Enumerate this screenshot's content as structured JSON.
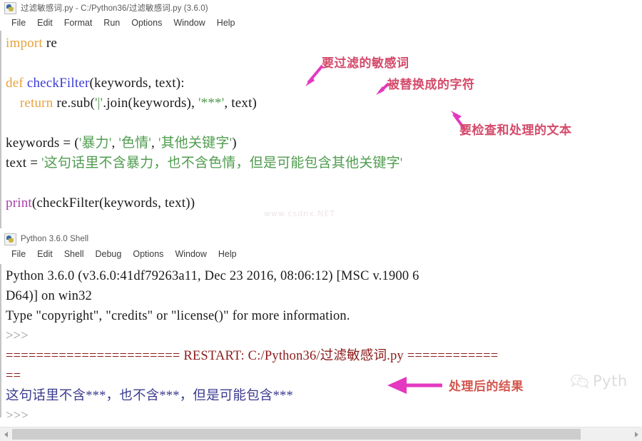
{
  "editor_window": {
    "title": "过滤敏感词.py - C:/Python36/过滤敏感词.py (3.6.0)",
    "icon": "python-file-icon",
    "menu": [
      "File",
      "Edit",
      "Format",
      "Run",
      "Options",
      "Window",
      "Help"
    ],
    "code_lines": [
      {
        "id": "l1",
        "segments": [
          {
            "t": "import",
            "c": "kw"
          },
          {
            "t": " re",
            "c": "plain"
          }
        ]
      },
      {
        "id": "l2",
        "segments": [
          {
            "t": "",
            "c": "plain"
          }
        ]
      },
      {
        "id": "l3",
        "segments": [
          {
            "t": "def",
            "c": "kw"
          },
          {
            "t": " ",
            "c": "plain"
          },
          {
            "t": "checkFilter",
            "c": "fn"
          },
          {
            "t": "(keywords, text):",
            "c": "plain"
          }
        ]
      },
      {
        "id": "l4",
        "segments": [
          {
            "t": "    ",
            "c": "plain"
          },
          {
            "t": "return",
            "c": "kw"
          },
          {
            "t": " re.sub(",
            "c": "plain"
          },
          {
            "t": "'|'",
            "c": "str"
          },
          {
            "t": ".join(keywords), ",
            "c": "plain"
          },
          {
            "t": "'***'",
            "c": "str"
          },
          {
            "t": ", text)",
            "c": "plain"
          }
        ]
      },
      {
        "id": "l5",
        "segments": [
          {
            "t": "",
            "c": "plain"
          }
        ]
      },
      {
        "id": "l6",
        "segments": [
          {
            "t": "keywords = (",
            "c": "plain"
          },
          {
            "t": "'暴力'",
            "c": "str"
          },
          {
            "t": ", ",
            "c": "plain"
          },
          {
            "t": "'色情'",
            "c": "str"
          },
          {
            "t": ", ",
            "c": "plain"
          },
          {
            "t": "'其他关键字'",
            "c": "str"
          },
          {
            "t": ")",
            "c": "plain"
          }
        ]
      },
      {
        "id": "l7",
        "segments": [
          {
            "t": "text = ",
            "c": "plain"
          },
          {
            "t": "'这句话里不含暴力，也不含色情，但是可能包含其他关键字'",
            "c": "str"
          }
        ]
      },
      {
        "id": "l8",
        "segments": [
          {
            "t": "",
            "c": "plain"
          }
        ]
      },
      {
        "id": "l9",
        "segments": [
          {
            "t": "print",
            "c": "bi"
          },
          {
            "t": "(checkFilter(keywords, text))",
            "c": "plain"
          }
        ]
      }
    ]
  },
  "shell_window": {
    "title": "Python 3.6.0 Shell",
    "icon": "python-shell-icon",
    "menu": [
      "File",
      "Edit",
      "Shell",
      "Debug",
      "Options",
      "Window",
      "Help"
    ],
    "output_lines": [
      {
        "id": "s1",
        "segments": [
          {
            "t": "Python 3.6.0 (v3.6.0:41df79263a11, Dec 23 2016, 08:06:12) [MSC v.1900 6",
            "c": "sh-plain"
          }
        ]
      },
      {
        "id": "s2",
        "segments": [
          {
            "t": "D64)] on win32",
            "c": "sh-plain"
          }
        ]
      },
      {
        "id": "s3",
        "segments": [
          {
            "t": "Type \"copyright\", \"credits\" or \"license()\" for more information.",
            "c": "sh-plain"
          }
        ]
      },
      {
        "id": "s4",
        "segments": [
          {
            "t": ">>>",
            "c": "sh-prompt"
          }
        ]
      },
      {
        "id": "s5",
        "segments": [
          {
            "t": "======================= RESTART: C:/Python36/",
            "c": "sh-restart"
          },
          {
            "t": "过滤敏感词.py",
            "c": "sh-restart"
          },
          {
            "t": " ============",
            "c": "sh-restart"
          }
        ]
      },
      {
        "id": "s6",
        "segments": [
          {
            "t": "==",
            "c": "sh-restart"
          }
        ]
      },
      {
        "id": "s7",
        "segments": [
          {
            "t": "这句话里不含***，也不含***，但是可能包含***",
            "c": "sh-out"
          }
        ]
      },
      {
        "id": "s8",
        "segments": [
          {
            "t": ">>>",
            "c": "sh-prompt"
          }
        ]
      }
    ]
  },
  "annotations": [
    {
      "id": "a1",
      "text": "要过滤的敏感词",
      "color": "#d44a6a"
    },
    {
      "id": "a2",
      "text": "被替换成的字符",
      "color": "#d44a6a"
    },
    {
      "id": "a3",
      "text": "要检查和处理的文本",
      "color": "#d44a6a"
    },
    {
      "id": "a4",
      "text": "处理后的结果",
      "color": "#d4564e"
    }
  ],
  "watermark": {
    "text": "Pyth",
    "icon": "wechat-icon",
    "faint_text": "www.csdnx.NET"
  },
  "scrollbar": {
    "left_arrow": "scroll-left-arrow",
    "right_arrow": "scroll-right-arrow",
    "thumb_width_percent": "92"
  },
  "colors": {
    "keyword": "#e8a33d",
    "definition": "#3a3ad6",
    "string": "#4f9c4f",
    "builtin": "#a63fa6",
    "stdout": "#3b3b8f",
    "restart": "#8b1a1a",
    "arrow": "#e438c0"
  }
}
